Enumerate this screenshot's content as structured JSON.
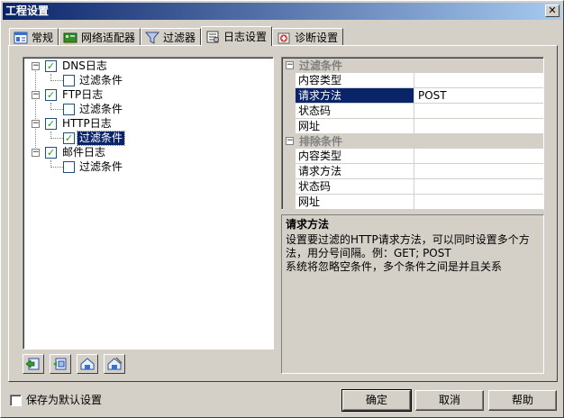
{
  "window": {
    "title": "工程设置",
    "close_glyph": "✕"
  },
  "tabs": [
    {
      "label": "常规",
      "icon": "general-icon"
    },
    {
      "label": "网络适配器",
      "icon": "network-adapter-icon"
    },
    {
      "label": "过滤器",
      "icon": "filter-funnel-icon"
    },
    {
      "label": "日志设置",
      "icon": "log-settings-icon",
      "active": true
    },
    {
      "label": "诊断设置",
      "icon": "diagnostics-icon"
    }
  ],
  "tree": {
    "nodes": [
      {
        "label": "DNS日志",
        "checked": true,
        "expander": "⊟",
        "children": [
          {
            "label": "过滤条件",
            "checked": false
          }
        ]
      },
      {
        "label": "FTP日志",
        "checked": true,
        "expander": "⊟",
        "children": [
          {
            "label": "过滤条件",
            "checked": false
          }
        ]
      },
      {
        "label": "HTTP日志",
        "checked": true,
        "expander": "⊟",
        "children": [
          {
            "label": "过滤条件",
            "checked": true,
            "selected": true
          }
        ]
      },
      {
        "label": "邮件日志",
        "checked": true,
        "expander": "⊟",
        "children": [
          {
            "label": "过滤条件",
            "checked": false
          }
        ]
      }
    ],
    "check_glyph": "✓",
    "minus_glyph": "−"
  },
  "toolbar": {
    "buttons": [
      {
        "name": "add-item-button",
        "icon": "add-item-icon"
      },
      {
        "name": "add-subitem-button",
        "icon": "add-subitem-icon"
      },
      {
        "name": "edit-item-button",
        "icon": "edit-item-icon"
      },
      {
        "name": "delete-item-button",
        "icon": "delete-item-icon"
      }
    ]
  },
  "grid": {
    "categories": [
      {
        "title": "过滤条件",
        "rows": [
          {
            "name": "内容类型",
            "value": ""
          },
          {
            "name": "请求方法",
            "value": "POST",
            "selected": true
          },
          {
            "name": "状态码",
            "value": ""
          },
          {
            "name": "网址",
            "value": ""
          }
        ]
      },
      {
        "title": "排除条件",
        "rows": [
          {
            "name": "内容类型",
            "value": ""
          },
          {
            "name": "请求方法",
            "value": ""
          },
          {
            "name": "状态码",
            "value": ""
          },
          {
            "name": "网址",
            "value": ""
          }
        ]
      }
    ]
  },
  "description": {
    "title": "请求方法",
    "body": "设置要过滤的HTTP请求方法，可以同时设置多个方法，用分号间隔。例：GET; POST\n系统将忽略空条件，多个条件之间是并且关系"
  },
  "footer": {
    "save_default_label": "保存为默认设置",
    "save_default_checked": false,
    "ok_label": "确定",
    "cancel_label": "取消",
    "help_label": "帮助"
  },
  "colors": {
    "title_start": "#0a246a",
    "title_end": "#a6caf0",
    "selection": "#0a246a",
    "dialog_bg": "#d4d0c8",
    "check_green": "#21a121"
  }
}
